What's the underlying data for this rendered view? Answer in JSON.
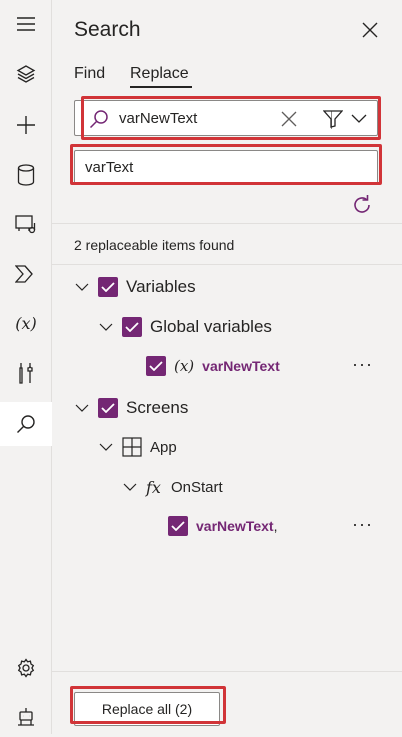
{
  "rail": {
    "items": [
      {
        "icon": "hamburger-menu-icon"
      },
      {
        "icon": "layers-icon"
      },
      {
        "icon": "plus-icon"
      },
      {
        "icon": "database-icon"
      },
      {
        "icon": "media-icon"
      },
      {
        "icon": "power-automate-icon"
      },
      {
        "icon": "variables-icon",
        "text": "(x)"
      },
      {
        "icon": "tools-icon"
      },
      {
        "icon": "search-icon",
        "active": true
      },
      {
        "icon": "settings-icon"
      },
      {
        "icon": "virtual-agent-icon"
      }
    ]
  },
  "panel": {
    "title": "Search",
    "tabs": [
      "Find",
      "Replace"
    ],
    "active_tab": "Replace",
    "search": {
      "value": "varNewText"
    },
    "replace": {
      "value": "varText"
    },
    "found_text": "2 replaceable items found",
    "tree": {
      "variables": "Variables",
      "global_variables": "Global variables",
      "var_item": {
        "prefix": "(x)",
        "name": "varNewText"
      },
      "screens": "Screens",
      "app": "App",
      "onstart": {
        "prefix": "fx",
        "name": "OnStart"
      },
      "onstart_item": {
        "name": "varNewText",
        "suffix": ","
      }
    },
    "more_label": "···",
    "replace_all": "Replace all (2)"
  },
  "colors": {
    "accent": "#742774",
    "highlight": "#d13438"
  }
}
